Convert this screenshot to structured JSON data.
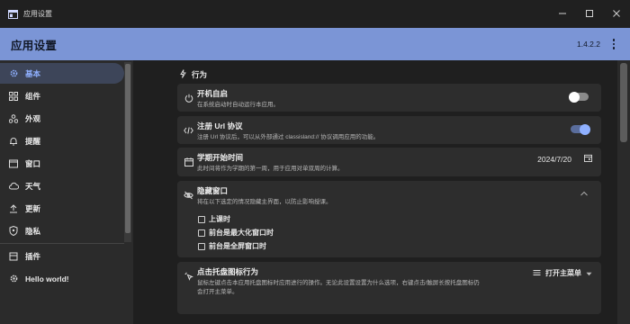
{
  "window": {
    "title": "应用设置",
    "icon": "app-window-icon",
    "controls": [
      "minimize-icon",
      "maximize-icon",
      "close-icon"
    ]
  },
  "header": {
    "title": "应用设置",
    "version": "1.4.2.2"
  },
  "sidebar": {
    "items": [
      {
        "label": "基本",
        "icon": "gear-icon",
        "active": true
      },
      {
        "label": "组件",
        "icon": "widgets-icon"
      },
      {
        "label": "外观",
        "icon": "shapes-icon"
      },
      {
        "label": "提醒",
        "icon": "bell-icon"
      },
      {
        "label": "窗口",
        "icon": "window-icon"
      },
      {
        "label": "天气",
        "icon": "cloud-icon"
      },
      {
        "label": "更新",
        "icon": "upload-icon"
      },
      {
        "label": "隐私",
        "icon": "shield-icon"
      }
    ],
    "bottom_items": [
      {
        "label": "插件",
        "icon": "puzzle-icon"
      },
      {
        "label": "Hello world!",
        "icon": "gear-icon"
      }
    ]
  },
  "main": {
    "section_title": "行为",
    "section_icon": "lightning-icon",
    "cards": {
      "autostart": {
        "title": "开机自启",
        "desc": "在系统启动时自动运行本应用。",
        "enabled": false
      },
      "url_protocol": {
        "title": "注册 Url 协议",
        "desc": "注册 Url 协议后，可以从外部通过 classisland:// 协议调用应用的功能。",
        "enabled": true
      },
      "semester_start": {
        "title": "学期开始时间",
        "desc": "此时间将作为学期的第一周，用于应用对单双周的计算。",
        "value": "2024/7/20"
      },
      "hide_window": {
        "title": "隐藏窗口",
        "desc": "将在以下选定的情况隐藏主界面，以防止影响授课。",
        "options": [
          "上课时",
          "前台是最大化窗口时",
          "前台是全屏窗口时"
        ]
      },
      "tray_click": {
        "title": "点击托盘图标行为",
        "desc_line1": "鼠标左键点击本应用托盘图标时应用进行的操作。无论此设置设置为什么选项，右键点击/触屏长按托盘图标仍",
        "desc_line2": "会打开主菜单。",
        "value": "打开主菜单"
      }
    }
  },
  "colors": {
    "accent": "#7b95d6",
    "accent_light": "#8fb0ff",
    "background": "#1f1f1f",
    "card": "#2d2d2d",
    "sidebar": "#2b2b2b"
  }
}
